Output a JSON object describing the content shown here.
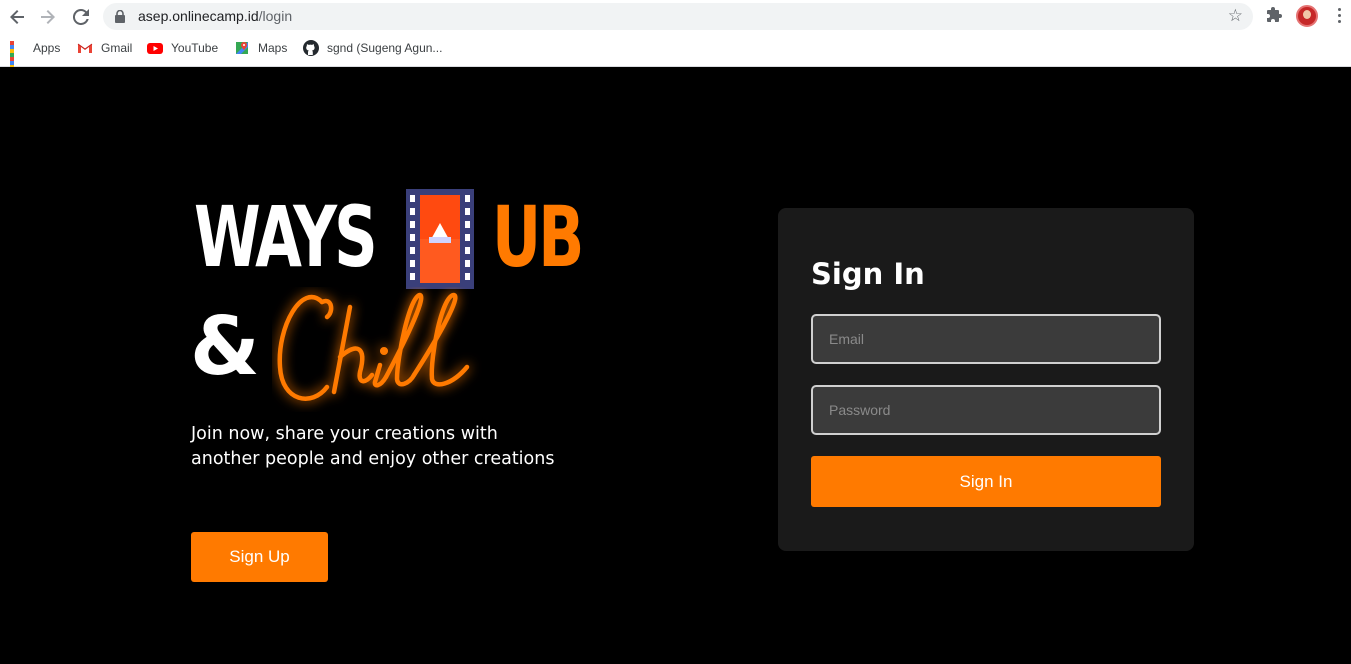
{
  "browser": {
    "url_host": "asep.onlinecamp.id",
    "url_path": "/login",
    "bookmarks": [
      {
        "label": "Apps"
      },
      {
        "label": "Gmail"
      },
      {
        "label": "YouTube"
      },
      {
        "label": "Maps"
      },
      {
        "label": "sgnd (Sugeng Agun..."
      }
    ]
  },
  "brand": {
    "word1": "WAYS",
    "word2": "UB",
    "amp": "&",
    "script": "Chill",
    "accent_color": "#ff7a00"
  },
  "hero": {
    "tagline": "Join now, share your creations with another people and enjoy other creations",
    "signup_label": "Sign Up"
  },
  "signin": {
    "title": "Sign In",
    "email_placeholder": "Email",
    "password_placeholder": "Password",
    "button_label": "Sign In"
  }
}
